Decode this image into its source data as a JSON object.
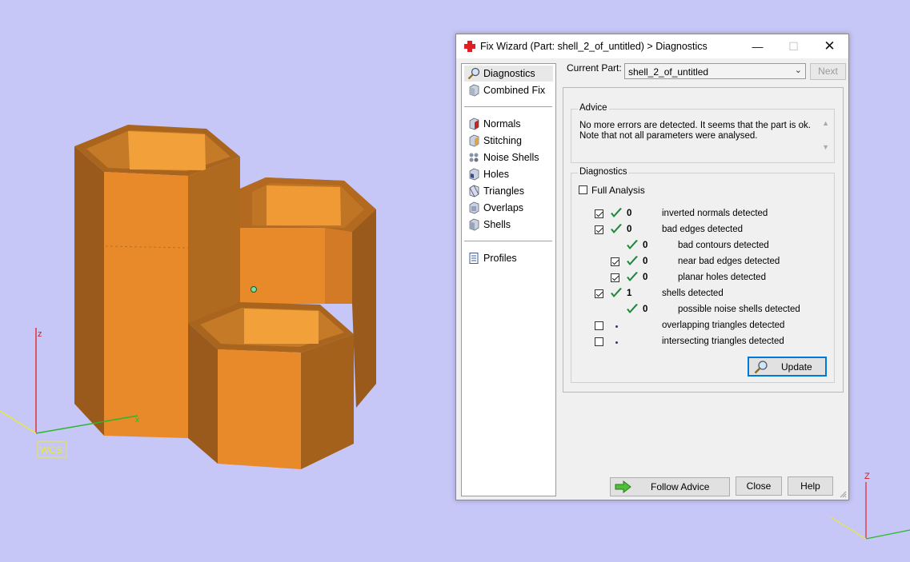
{
  "viewport": {
    "wcs_label": "WCS",
    "axis_z": "z",
    "axis_x": "x",
    "corner_axis_z": "Z",
    "colors": {
      "background": "#c6c6f7",
      "part_front": "#e8892a",
      "part_side": "#9a5a1b",
      "part_inner": "#f0a040",
      "x_axis": "#2ab82a",
      "y_axis": "#e8e83c",
      "z_axis": "#e03030"
    }
  },
  "dialog": {
    "title": "Fix Wizard (Part: shell_2_of_untitled) > Diagnostics",
    "window_controls": {
      "minimize": "—",
      "maximize": "☐",
      "close": "✕"
    },
    "nav": {
      "items": [
        {
          "label": "Diagnostics",
          "icon": "magnifier-icon",
          "selected": true
        },
        {
          "label": "Combined Fix",
          "icon": "cube-icon"
        },
        {
          "label": "Normals",
          "icon": "normals-cube-icon"
        },
        {
          "label": "Stitching",
          "icon": "stitching-cube-icon"
        },
        {
          "label": "Noise Shells",
          "icon": "noise-shells-icon"
        },
        {
          "label": "Holes",
          "icon": "holes-cube-icon"
        },
        {
          "label": "Triangles",
          "icon": "triangles-cube-icon"
        },
        {
          "label": "Overlaps",
          "icon": "overlaps-cube-icon"
        },
        {
          "label": "Shells",
          "icon": "shells-cube-icon"
        },
        {
          "label": "Profiles",
          "icon": "document-icon"
        }
      ]
    },
    "current_part_label": "Current Part:",
    "current_part_value": "shell_2_of_untitled",
    "next_button": "Next",
    "advice": {
      "title": "Advice",
      "line1": "No more errors are detected. It seems that the part is ok.",
      "line2": "Note that not all parameters were analysed."
    },
    "diagnostics": {
      "title": "Diagnostics",
      "full_analysis_label": "Full Analysis",
      "full_analysis_checked": false,
      "rows": [
        {
          "checked": true,
          "status": "ok",
          "count": "0",
          "label": "inverted normals detected"
        },
        {
          "checked": true,
          "status": "ok",
          "count": "0",
          "label": "bad edges detected"
        },
        {
          "checked": null,
          "status": "ok",
          "count": "0",
          "label": "bad contours detected"
        },
        {
          "checked": true,
          "status": "ok",
          "count": "0",
          "label": "near bad edges detected"
        },
        {
          "checked": true,
          "status": "ok",
          "count": "0",
          "label": "planar holes detected"
        },
        {
          "checked": true,
          "status": "ok",
          "count": "1",
          "label": "shells detected"
        },
        {
          "checked": null,
          "status": "ok",
          "count": "0",
          "label": "possible noise shells detected"
        },
        {
          "checked": false,
          "status": "pending",
          "count": "",
          "label": "overlapping triangles detected"
        },
        {
          "checked": false,
          "status": "pending",
          "count": "",
          "label": "intersecting triangles detected"
        }
      ],
      "update_button": "Update"
    },
    "follow_advice_button": "Follow Advice",
    "close_button": "Close",
    "help_button": "Help"
  }
}
